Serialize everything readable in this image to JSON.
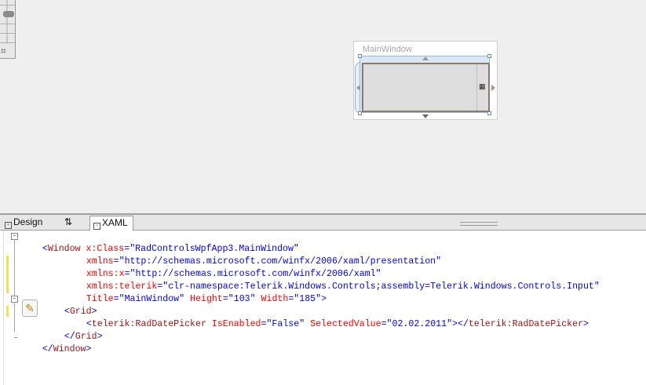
{
  "designer": {
    "window_title": "MainWindow"
  },
  "tabs": {
    "design": "Design",
    "swap": "⇅",
    "xaml": "XAML"
  },
  "code": {
    "l1": {
      "a": "<",
      "b": "Window",
      "c": " x:Class",
      "d": "=\"",
      "e": "RadControlsWpfApp3.MainWindow",
      "f": "\""
    },
    "l2": {
      "a": "xmlns",
      "b": "=\"",
      "c": "http://schemas.microsoft.com/winfx/2006/xaml/presentation",
      "d": "\""
    },
    "l3": {
      "a": "xmlns:x",
      "b": "=\"",
      "c": "http://schemas.microsoft.com/winfx/2006/xaml",
      "d": "\""
    },
    "l4": {
      "a": "xmlns:telerik",
      "b": "=\"",
      "c": "clr-namespace:Telerik.Windows.Controls;assembly=Telerik.Windows.Controls.Input",
      "d": "\""
    },
    "l5": {
      "a": "Title",
      "b": "=\"",
      "c": "MainWindow",
      "d": "\"",
      "e": " Height",
      "f": "=\"",
      "g": "103",
      "h": "\"",
      "i": " Width",
      "j": "=\"",
      "k": "185",
      "l": "\">"
    },
    "l6": {
      "a": "<",
      "b": "Grid",
      "c": ">"
    },
    "l7": {
      "a": "<",
      "b": "telerik:RadDatePicker",
      "c": " IsEnabled",
      "d": "=\"",
      "e": "False",
      "f": "\"",
      "g": " SelectedValue",
      "h": "=\"",
      "i": "02.02.2011",
      "j": "\"></",
      "k": "telerik:RadDatePicker",
      "l": ">"
    },
    "l8": {
      "a": "</",
      "b": "Grid",
      "c": ">"
    },
    "l9": {
      "a": "</",
      "b": "Window",
      "c": ">"
    }
  },
  "colors": {
    "tag": "#a31515",
    "attr": "#ff0000",
    "punct": "#0000ff"
  },
  "icons": {
    "design_tab": "design-view-icon",
    "xaml_tab": "xaml-view-icon",
    "edit": "pencil-icon"
  }
}
